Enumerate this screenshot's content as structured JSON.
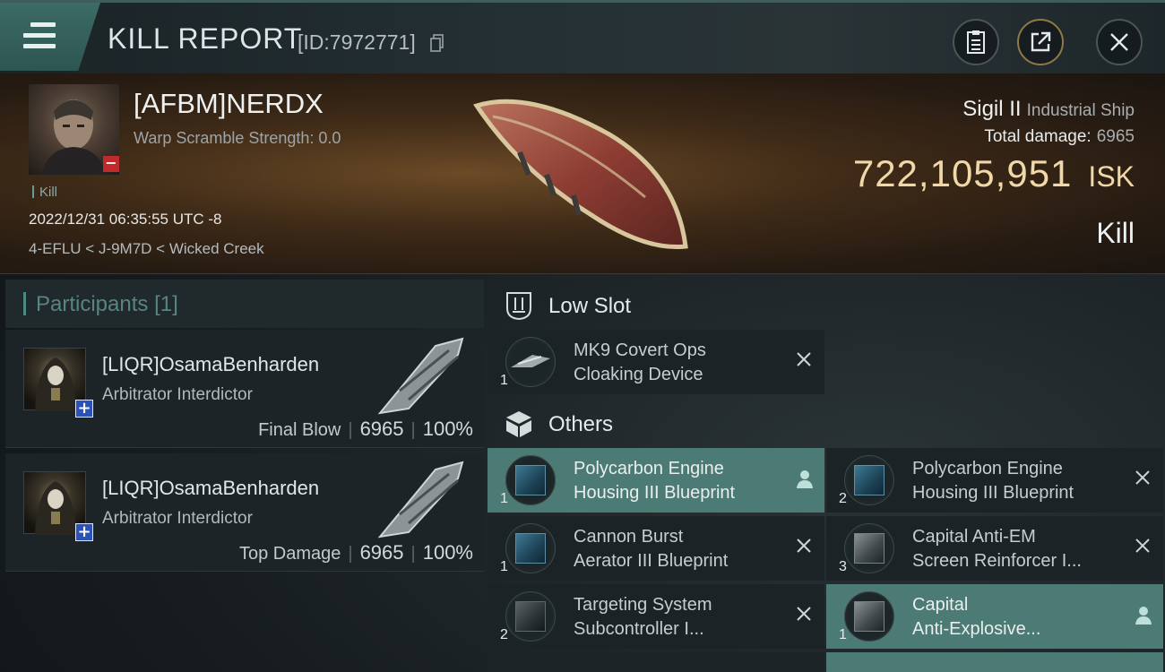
{
  "header": {
    "title": "KILL REPORT",
    "report_id": "[ID:7972771]"
  },
  "victim": {
    "name": "[AFBM]NERDX",
    "warp_scramble": "Warp Scramble Strength: 0.0",
    "tag": "Kill",
    "datetime": "2022/12/31 06:35:55 UTC -8",
    "location": "4-EFLU < J-9M7D < Wicked Creek",
    "ship_name": "Sigil II",
    "ship_class": "Industrial Ship",
    "total_damage_label": "Total damage:",
    "total_damage": "6965",
    "isk_value": "722,105,951",
    "isk_unit": "ISK",
    "result": "Kill"
  },
  "participants": {
    "title": "Participants",
    "count": "[1]",
    "rows": [
      {
        "name": "[LIQR]OsamaBenharden",
        "ship": "Arbitrator Interdictor",
        "role": "Final Blow",
        "damage": "6965",
        "percent": "100%"
      },
      {
        "name": "[LIQR]OsamaBenharden",
        "ship": "Arbitrator Interdictor",
        "role": "Top Damage",
        "damage": "6965",
        "percent": "100%"
      }
    ]
  },
  "sections": {
    "low_slot": "Low Slot",
    "others": "Others"
  },
  "items": {
    "low": [
      {
        "line1": "MK9 Covert Ops",
        "line2": "Cloaking Device",
        "qty": "1"
      }
    ],
    "others": [
      {
        "line1": "Polycarbon Engine",
        "line2": "Housing III Blueprint",
        "qty": "1"
      },
      {
        "line1": "Polycarbon Engine",
        "line2": "Housing III Blueprint",
        "qty": "2"
      },
      {
        "line1": "Cannon Burst",
        "line2": "Aerator III Blueprint",
        "qty": "1"
      },
      {
        "line1": "Capital Anti-EM",
        "line2": "Screen Reinforcer I...",
        "qty": "3"
      },
      {
        "line1": "Targeting System",
        "line2": "Subcontroller I...",
        "qty": "2"
      },
      {
        "line1": "Capital",
        "line2": "Anti-Explosive...",
        "qty": "1"
      }
    ]
  },
  "icons": {
    "menu": "menu-icon",
    "copy": "copy-icon",
    "report": "clipboard-icon",
    "share": "share-icon",
    "close": "close-icon"
  },
  "colors": {
    "accent": "#4c7a74",
    "isk": "#f0d8a8",
    "plus_badge": "#2b52b6",
    "minus_badge": "#c02a2a"
  }
}
